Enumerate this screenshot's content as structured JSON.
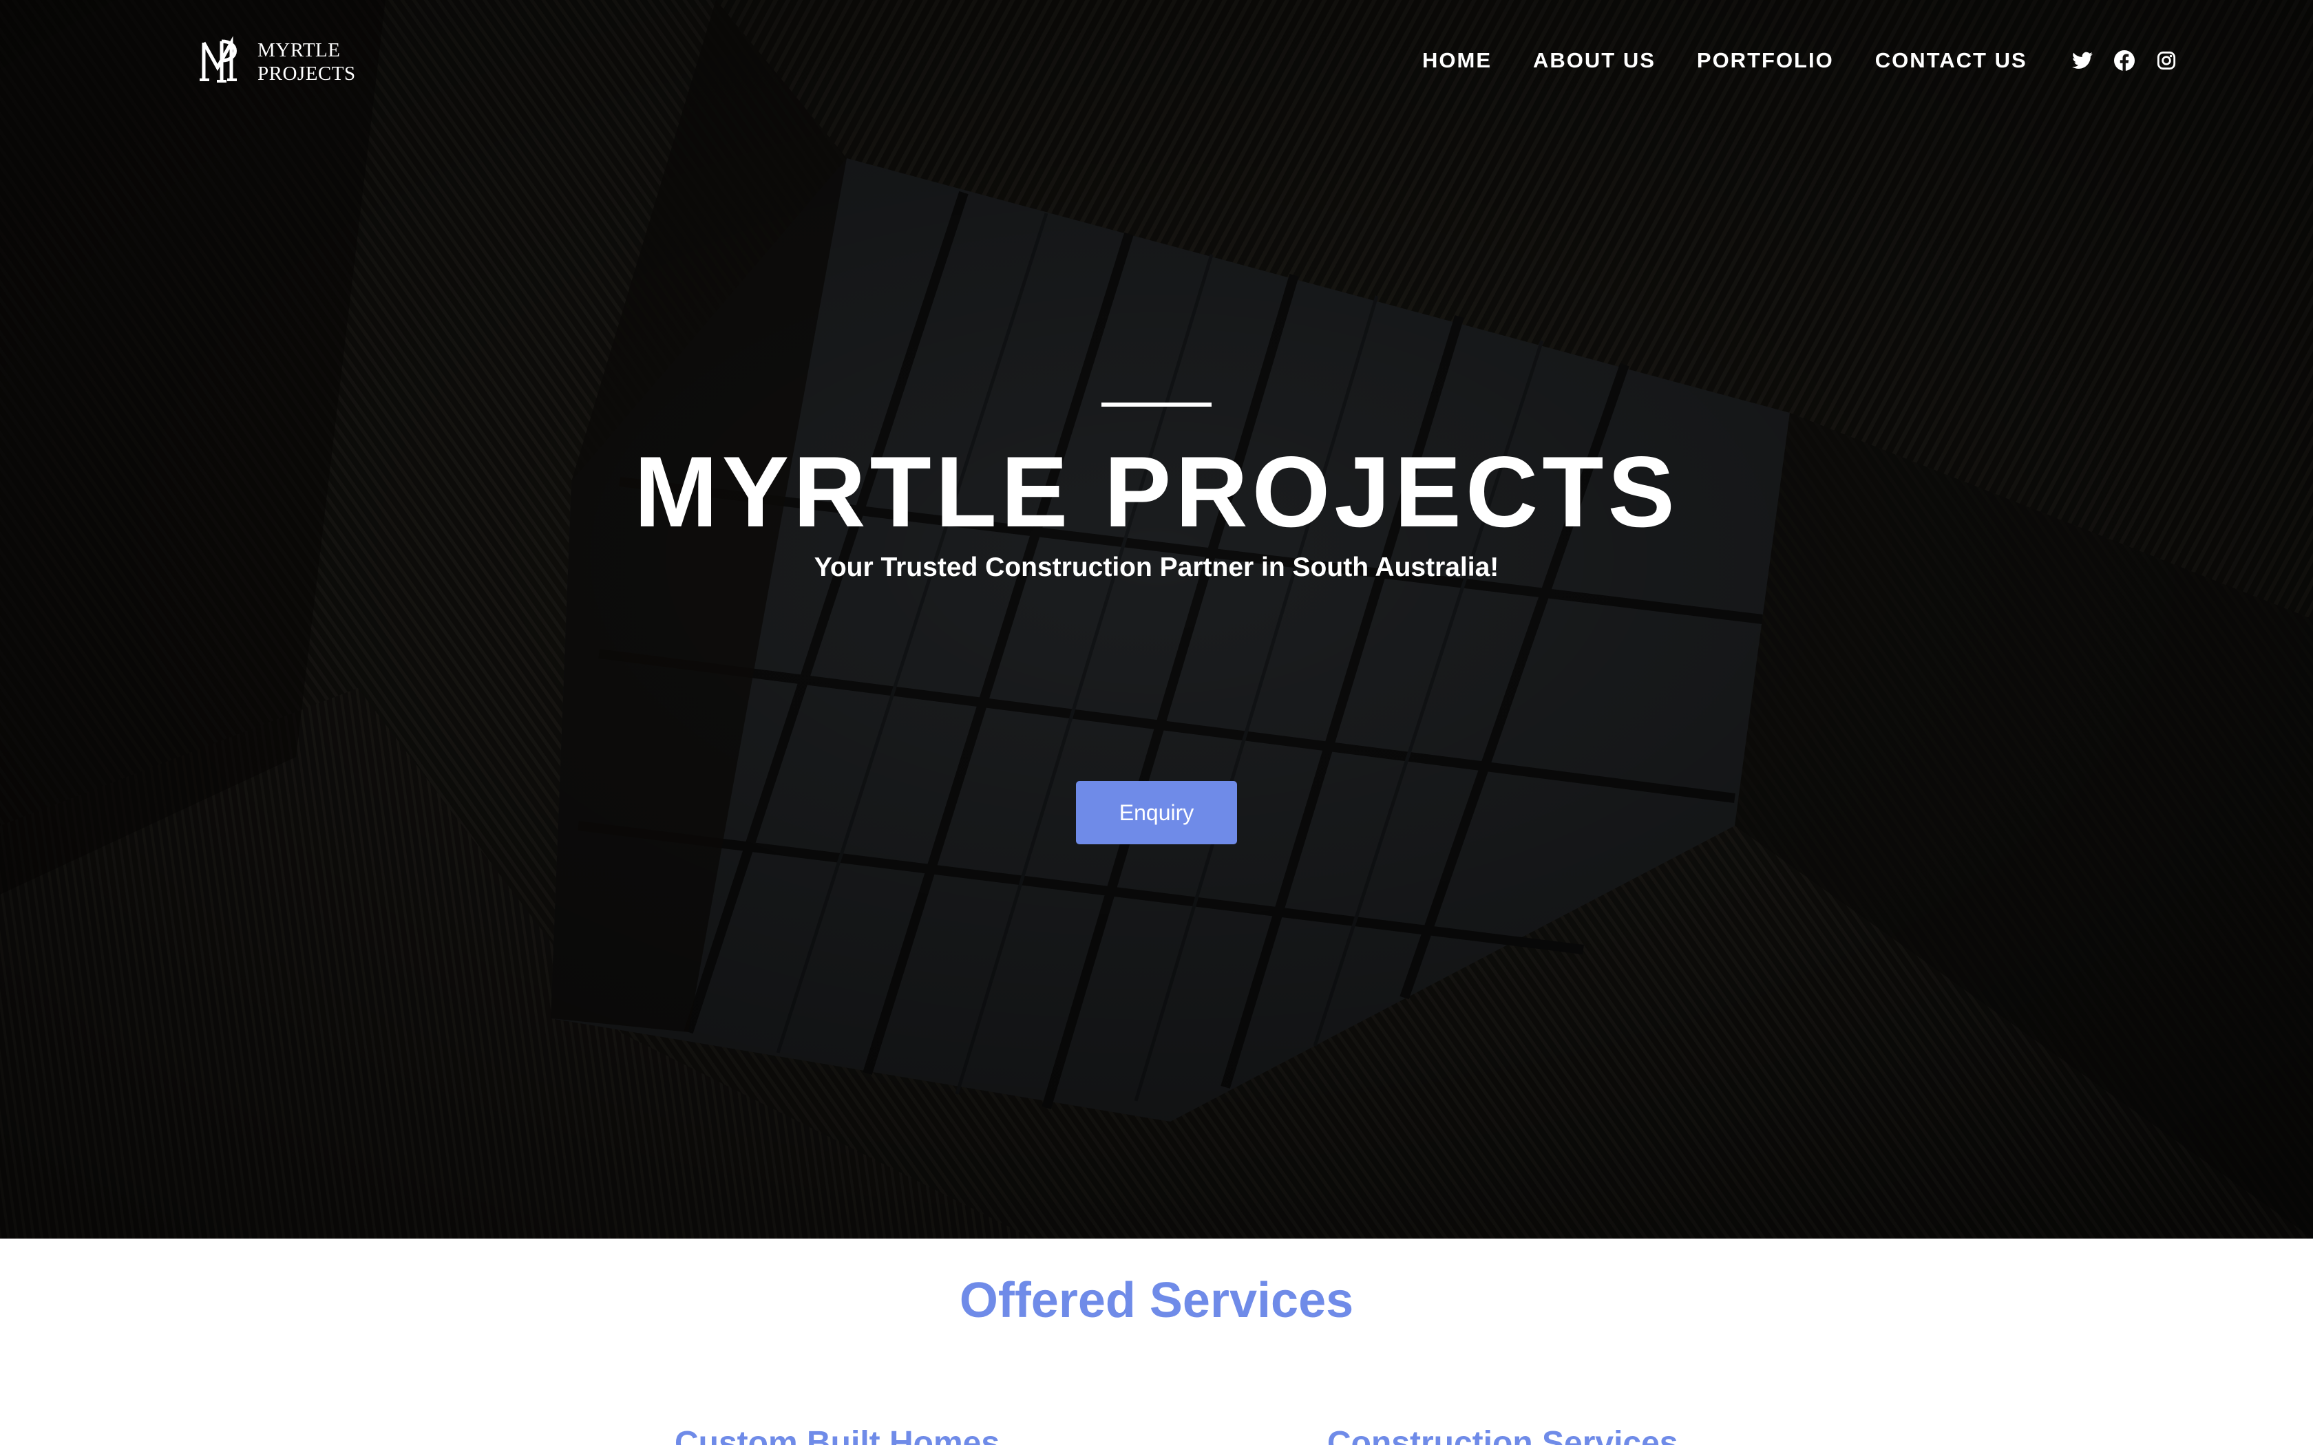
{
  "brand": {
    "logo_line1": "MYRTLE",
    "logo_line2": "PROJECTS"
  },
  "nav": {
    "items": [
      {
        "label": "HOME"
      },
      {
        "label": "ABOUT US"
      },
      {
        "label": "PORTFOLIO"
      },
      {
        "label": "CONTACT US"
      }
    ],
    "social": [
      "twitter-icon",
      "facebook-icon",
      "instagram-icon"
    ]
  },
  "hero": {
    "title": "MYRTLE PROJECTS",
    "subtitle": "Your Trusted Construction Partner in South Australia!",
    "cta_label": "Enquiry"
  },
  "services": {
    "title": "Offered Services",
    "items": [
      {
        "label": "Custom Built Homes"
      },
      {
        "label": "Construction Services"
      }
    ]
  },
  "colors": {
    "accent": "#6f8be8",
    "hero_bg": "#141210",
    "text_light": "#ffffff"
  }
}
